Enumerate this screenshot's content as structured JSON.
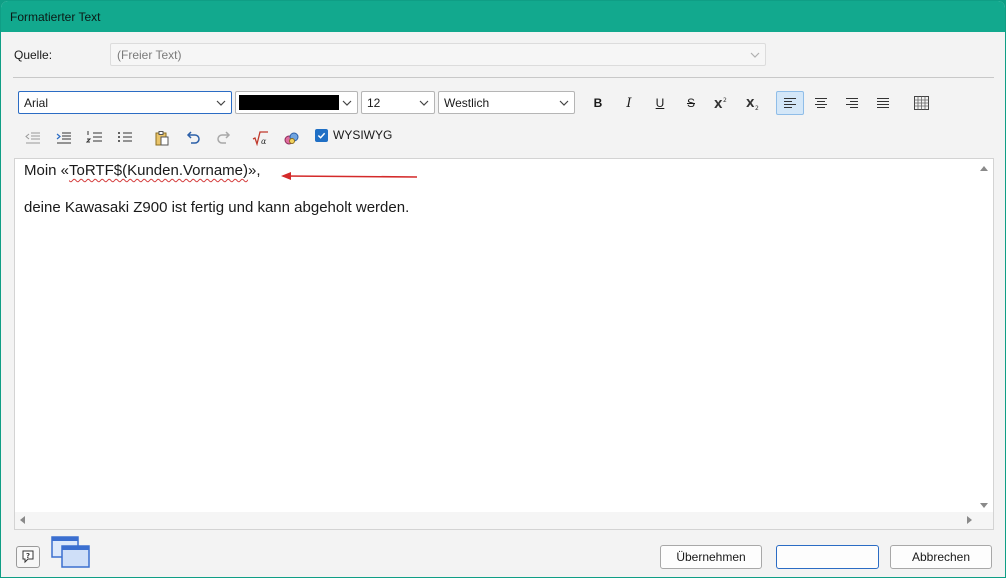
{
  "window": {
    "title": "Formatierter Text"
  },
  "source": {
    "label": "Quelle:",
    "value": "(Freier Text)"
  },
  "toolbar": {
    "font": "Arial",
    "color": "#000000",
    "size": "12",
    "script": "Westlich",
    "bold": "B",
    "italic": "I",
    "underline": "U",
    "strike": "S",
    "wysiwyg": {
      "label": "WYSIWYG",
      "checked": true
    }
  },
  "editor": {
    "line1_prefix": "Moin «",
    "line1_field": "ToRTF$(Kunden.Vorname)",
    "line1_suffix": "»,",
    "line2": "deine Kawasaki Z900 ist fertig und kann abgeholt werden."
  },
  "footer": {
    "apply": "Übernehmen",
    "blank": "",
    "cancel": "Abbrechen"
  },
  "colors": {
    "accent": "#12a98e",
    "arrow": "#d42a2a"
  }
}
